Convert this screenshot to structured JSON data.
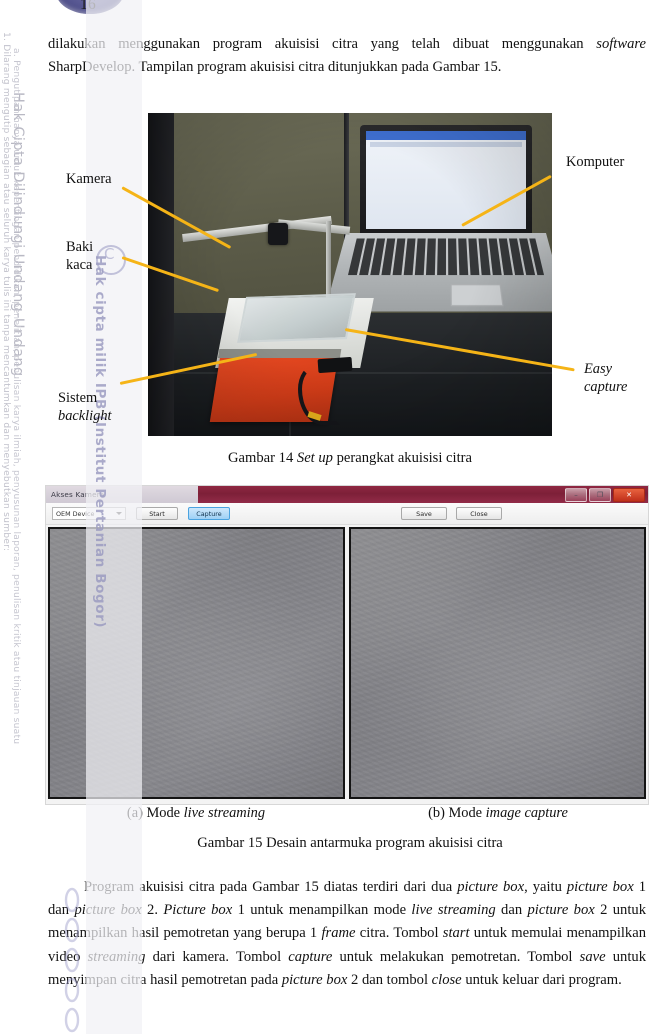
{
  "page": {
    "number": "16",
    "logo_alt": "IPB University seal"
  },
  "watermark": {
    "title": "Hak Cipta Dilindungi Undang-Undang",
    "line1": "1. Dilarang mengutip sebagian atau seluruh karya tulis ini tanpa mencantumkan dan menyebutkan sumber:",
    "line2": "a. Pengutipan hanya untuk kepentingan pendidikan, penelitian, penulisan karya ilmiah, penyusunan laporan, penulisan kritik atau tinjauan suatu",
    "center": "Hak cipta milik IPB (Institut Pertanian Bogor)",
    "copyright_symbol": "C"
  },
  "paragraph_top": {
    "segments": [
      {
        "text": "dilakukan menggunakan program akuisisi citra yang telah dibuat menggunakan ",
        "italic": false
      },
      {
        "text": "software",
        "italic": true
      },
      {
        "text": " SharpDevelop. Tampilan program akuisisi citra ditunjukkan pada Gambar 15.",
        "italic": false
      }
    ]
  },
  "figure14": {
    "labels": [
      {
        "id": "kamera",
        "lines": [
          "Kamera"
        ],
        "italic_lines": []
      },
      {
        "id": "baki-kaca",
        "lines": [
          "Baki",
          "kaca"
        ],
        "italic_lines": []
      },
      {
        "id": "sistem-backlight",
        "lines": [
          "Sistem",
          "backlight"
        ],
        "italic_lines": [
          1
        ]
      },
      {
        "id": "komputer",
        "lines": [
          "Komputer"
        ],
        "italic_lines": []
      },
      {
        "id": "easy-capture",
        "lines": [
          "Easy",
          "capture"
        ],
        "italic_lines": [
          0,
          1
        ]
      }
    ],
    "caption_parts": [
      {
        "text": "Gambar 14  ",
        "italic": false
      },
      {
        "text": "Set up",
        "italic": true
      },
      {
        "text": " perangkat akuisisi citra",
        "italic": false
      }
    ],
    "leader_color": "#f5b417"
  },
  "figure15": {
    "window": {
      "title": "Akses Kamera",
      "controls": [
        {
          "name": "minimize",
          "glyph": "–"
        },
        {
          "name": "maximize",
          "glyph": "❐"
        },
        {
          "name": "close",
          "glyph": "✕"
        }
      ],
      "toolbar": {
        "device_select": {
          "value": "OEM Device",
          "options": [
            "OEM Device"
          ]
        },
        "start_label": "Start",
        "capture_label": "Capture",
        "save_label": "Save",
        "close_label": "Close"
      },
      "picture_boxes": [
        {
          "name": "picture-box-1",
          "mode": "live streaming"
        },
        {
          "name": "picture-box-2",
          "mode": "image capture"
        }
      ]
    },
    "subcaptions": [
      {
        "prefix": "(a) Mode ",
        "italic": "live streaming"
      },
      {
        "prefix": "(b) Mode ",
        "italic": "image capture"
      }
    ],
    "caption": "Gambar 15 Desain antarmuka program akuisisi citra"
  },
  "paragraph_bottom": {
    "segments": [
      {
        "text": "Program akuisisi citra pada Gambar 15 diatas terdiri dari dua ",
        "italic": false
      },
      {
        "text": "picture box",
        "italic": true
      },
      {
        "text": ", yaitu ",
        "italic": false
      },
      {
        "text": "picture box",
        "italic": true
      },
      {
        "text": " 1 dan ",
        "italic": false
      },
      {
        "text": "picture box",
        "italic": true
      },
      {
        "text": " 2. ",
        "italic": false
      },
      {
        "text": "Picture box",
        "italic": true
      },
      {
        "text": " 1 untuk menampilkan mode ",
        "italic": false
      },
      {
        "text": "live streaming",
        "italic": true
      },
      {
        "text": " dan ",
        "italic": false
      },
      {
        "text": "picture box",
        "italic": true
      },
      {
        "text": " 2 untuk menampilkan hasil pemotretan yang berupa 1 ",
        "italic": false
      },
      {
        "text": "frame",
        "italic": true
      },
      {
        "text": " citra.  Tombol ",
        "italic": false
      },
      {
        "text": "start",
        "italic": true
      },
      {
        "text": " untuk memulai menampilkan video ",
        "italic": false
      },
      {
        "text": "streaming",
        "italic": true
      },
      {
        "text": " dari kamera. Tombol ",
        "italic": false
      },
      {
        "text": "capture",
        "italic": true
      },
      {
        "text": " untuk melakukan pemotretan. Tombol ",
        "italic": false
      },
      {
        "text": "save",
        "italic": true
      },
      {
        "text": " untuk menyimpan citra hasil pemotretan pada ",
        "italic": false
      },
      {
        "text": "picture box",
        "italic": true
      },
      {
        "text": " 2 dan tombol ",
        "italic": false
      },
      {
        "text": "close",
        "italic": true
      },
      {
        "text": " untuk keluar dari program.",
        "italic": false
      }
    ]
  }
}
